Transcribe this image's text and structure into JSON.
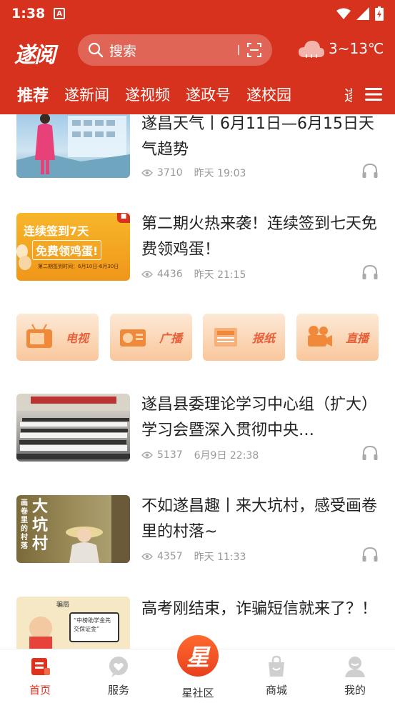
{
  "status": {
    "time": "1:38"
  },
  "header": {
    "logo": "遂阅",
    "search_placeholder": "搜索",
    "weather": "3~13℃"
  },
  "tabs": [
    "推荐",
    "遂新闻",
    "遂视频",
    "遂政号",
    "遂校园",
    "遂"
  ],
  "news": [
    {
      "title": "遂昌天气丨6月11日—6月15日天气趋势",
      "views": "3710",
      "date": "昨天 19:03"
    },
    {
      "title": "第二期火热来袭！连续签到七天免费领鸡蛋！",
      "views": "4436",
      "date": "昨天 21:15",
      "thumb_text_1": "连续签到7天",
      "thumb_text_2": "免费领鸡蛋!",
      "thumb_text_3": "第二期签到时间：6月10日-6月30日"
    },
    {
      "title": "遂昌县委理论学习中心组（扩大）学习会暨深入贯彻中央…",
      "views": "5137",
      "date": "6月9日 22:38"
    },
    {
      "title": "不如遂昌趣丨来大坑村，感受画卷里的村落~",
      "views": "4357",
      "date": "昨天 11:33",
      "thumb_text_1": "大坑村",
      "thumb_text_2": "画卷里的村落"
    },
    {
      "title": "高考刚结束，诈骗短信就来了？！",
      "thumb_text_1": "骗局",
      "thumb_text_2": "“中榜助学金先交保证金”"
    }
  ],
  "media": [
    "电视",
    "广播",
    "报纸",
    "直播"
  ],
  "bottom_nav": {
    "home": "首页",
    "service": "服务",
    "star_glyph": "星",
    "community": "星社区",
    "mall": "商城",
    "mine": "我的"
  },
  "colors": {
    "brand": "#d6321e",
    "active": "#e0301e",
    "meta": "#999999"
  }
}
